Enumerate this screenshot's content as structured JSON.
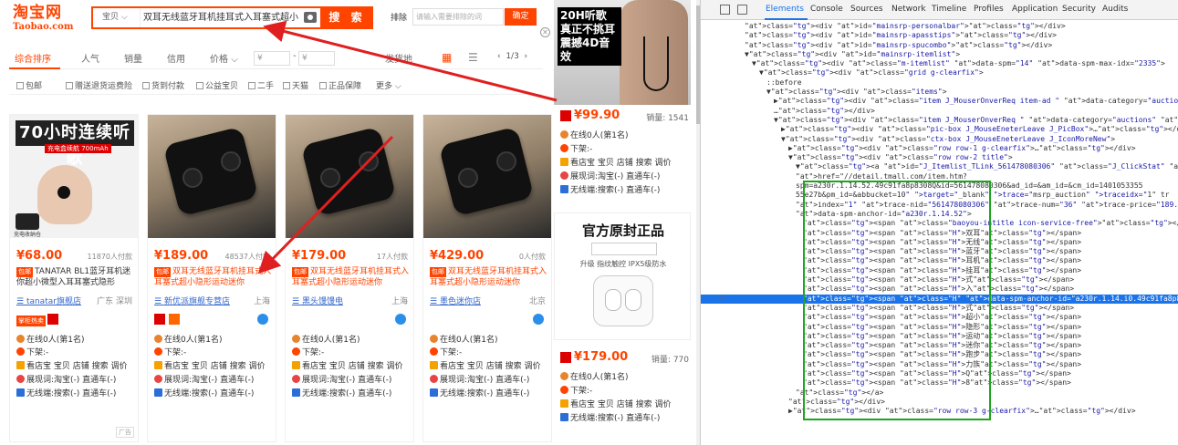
{
  "header": {
    "logo_cn": "淘宝网",
    "logo_en": "Taobao.com",
    "search_category": "宝贝",
    "search_query": "双耳无线蓝牙耳机挂耳式入耳塞式超小",
    "search_button": "搜 索",
    "exclude_label": "排除",
    "exclude_placeholder": "请输入需要排除的词",
    "ok_button": "确定"
  },
  "sortbar": {
    "items": [
      "综合排序",
      "人气",
      "销量",
      "信用",
      "价格"
    ],
    "price_from": "¥",
    "price_to": "¥",
    "ship_from": "发货地",
    "page": "1/3"
  },
  "filters": [
    "包邮",
    "赠送退货运费险",
    "货到付款",
    "公益宝贝",
    "二手",
    "天猫",
    "正品保障",
    "更多"
  ],
  "products": [
    {
      "promo_title": "70小时连续听歌",
      "promo_sub": "充电盒续航 700mAh",
      "img_caption": "充电收纳仓",
      "price": "¥68.00",
      "sold": "11870人付款",
      "tag": "包邮",
      "title": "TANATAR BL1蓝牙耳机迷你超小微型入耳耳塞式隐形",
      "shop": "tanatar旗舰店",
      "location": "广东 深圳",
      "badge_text": "掌柜热卖",
      "ad": "广告"
    },
    {
      "price": "¥189.00",
      "sold": "48537人付款",
      "tag": "包邮",
      "title": "双耳无线蓝牙耳机挂耳式入耳塞式超小隐形运动迷你",
      "shop": "新优派旗舰专营店",
      "location": "上海"
    },
    {
      "price": "¥179.00",
      "sold": "17人付款",
      "tag": "包邮",
      "title": "双耳无线蓝牙耳机挂耳式入耳塞式超小隐形运动迷你",
      "shop": "黑头馒馒电",
      "location": "上海"
    },
    {
      "price": "¥429.00",
      "sold": "0人付款",
      "tag": "包邮",
      "title": "双耳无线蓝牙耳机挂耳式入耳塞式超小隐形运动迷你",
      "shop": "墨色迷你店",
      "location": "北京"
    }
  ],
  "info_lines": [
    "在线0人(第1名)",
    "下架:-",
    "看店宝 宝贝 店铺 搜索 调价",
    "展现词:淘宝(-) 直通车(-)",
    "无线端:搜索(-) 直通车(-)"
  ],
  "ads": {
    "ad1_text": "20H听歌 真正不挑耳 震撼4D音效",
    "ad1_price": "¥99.90",
    "ad1_sold": "销量: 1541",
    "ad2_title": "官方原封正品",
    "ad2_sub": "升级 指纹触控 IPX5级防水",
    "ad2_price": "¥179.00",
    "ad2_sold": "销量: 770"
  },
  "devtools": {
    "tabs": [
      "Elements",
      "Console",
      "Sources",
      "Network",
      "Timeline",
      "Profiles",
      "Application",
      "Security",
      "Audits"
    ],
    "dom_lines": [
      {
        "i": 6,
        "t": "<div id=\"mainsrp-personalbar\"></div>"
      },
      {
        "i": 6,
        "t": "<div id=\"mainsrp-apasstips\"></div>"
      },
      {
        "i": 6,
        "t": "<div id=\"mainsrp-spucombo\"></div>"
      },
      {
        "i": 6,
        "t": "▼<div id=\"mainsrp-itemlist\">"
      },
      {
        "i": 7,
        "t": "▼<div class=\"m-itemlist\" data-spm=\"14\" data-spm-max-idx=\"2335\">"
      },
      {
        "i": 8,
        "t": "▼<div class=\"grid g-clearfix\">"
      },
      {
        "i": 9,
        "t": "::before"
      },
      {
        "i": 9,
        "t": "▼<div class=\"items\">"
      },
      {
        "i": 10,
        "t": "▶<div class=\"item J_MouserOnverReq item-ad  \" data-category=\"auctions\" data-index=\"0"
      },
      {
        "i": 10,
        "t": "…</div>"
      },
      {
        "i": 10,
        "t": "▼<div class=\"item J_MouserOnverReq  \" data-category=\"auctions\" data-index=\"1\">"
      },
      {
        "i": 11,
        "t": "▶<div class=\"pic-box J_MouseEneterLeave J_PicBox\">…</div>"
      },
      {
        "i": 11,
        "t": "▼<div class=\"ctx-box J_MouseEneterLeave J_IconMoreNew\">"
      },
      {
        "i": 12,
        "t": "▶<div class=\"row row-1 g-clearfix\">…</div>"
      },
      {
        "i": 12,
        "t": "▼<div class=\"row row-2 title\">"
      },
      {
        "i": 13,
        "t": "▼<a id=\"J_Itemlist_TLink_561478080306\" class=\"J_ClickStat\" data-nid=\"56147808"
      },
      {
        "i": 13,
        "t": "href=\"//detail.tmall.com/item.htm?"
      },
      {
        "i": 13,
        "t": "spm=a230r.1.14.52.49c91fa8p8308Q&id=561478080306&ad_id=&am_id=&cm_id=1401053355"
      },
      {
        "i": 13,
        "t": "55e27b&pm_id=&abbucket=10\" target=\"_blank\" trace=\"msrp_auction\" traceidx=\"1\" tr"
      },
      {
        "i": 13,
        "t": "index=\"1\" trace-nid=\"561478080306\" trace-num=\"36\" trace-price=\"189.00\" trace-pi"
      },
      {
        "i": 13,
        "t": "data-spm-anchor-id=\"a230r.1.14.52\">"
      },
      {
        "i": 14,
        "t": "<span class=\"baoyou-intitle icon-service-free\"></span>"
      },
      {
        "i": 14,
        "t": "<span class=\"H\">双耳</span>"
      },
      {
        "i": 14,
        "t": "<span class=\"H\">无线</span>"
      },
      {
        "i": 14,
        "t": "<span class=\"H\">蓝牙</span>"
      },
      {
        "i": 14,
        "t": "<span class=\"H\">耳机</span>"
      },
      {
        "i": 14,
        "t": "<span class=\"H\">挂耳</span>"
      },
      {
        "i": 14,
        "t": "<span class=\"H\">式</span>"
      },
      {
        "i": 14,
        "t": "<span class=\"H\">入</span>"
      },
      {
        "i": 14,
        "t": "<span class=\"H\" data-spm-anchor-id=\"a230r.1.14.i0.49c91fa8p8308Q\">耳塞</span>",
        "sel": true
      },
      {
        "i": 14,
        "t": "<span class=\"H\">式</span>"
      },
      {
        "i": 14,
        "t": "<span class=\"H\">超小</span>"
      },
      {
        "i": 14,
        "t": "<span class=\"H\">隐形</span>"
      },
      {
        "i": 14,
        "t": "<span class=\"H\">运动</span>"
      },
      {
        "i": 14,
        "t": "<span class=\"H\">迷你</span>"
      },
      {
        "i": 14,
        "t": "<span class=\"H\">跑步</span>"
      },
      {
        "i": 14,
        "t": "<span class=\"H\">力族</span>"
      },
      {
        "i": 14,
        "t": "<span class=\"H\">Q</span>"
      },
      {
        "i": 14,
        "t": "<span class=\"H\">8</span>"
      },
      {
        "i": 13,
        "t": "</a>"
      },
      {
        "i": 12,
        "t": "</div>"
      },
      {
        "i": 12,
        "t": "▶<div class=\"row row-3 g-clearfix\">…</div>"
      }
    ]
  },
  "colors": {
    "brand": "#ff4400",
    "devtools_select": "#1a73e8",
    "annotation_box": "#1ea51e"
  }
}
